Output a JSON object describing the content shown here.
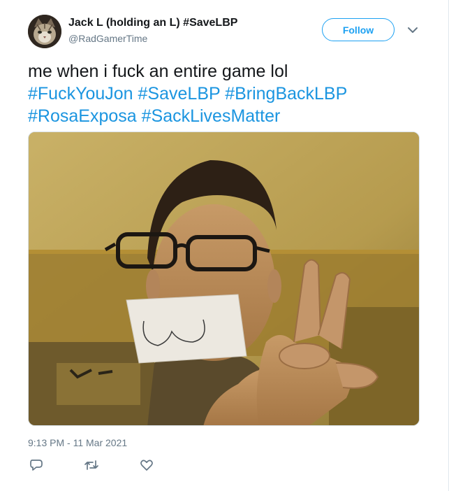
{
  "tweet": {
    "author": {
      "display_name": "Jack L (holding an L) #SaveLBP",
      "handle": "@RadGamerTime"
    },
    "follow_label": "Follow",
    "text_plain": "me when i fuck an entire game lol",
    "hashtags": [
      "#FuckYouJon",
      "#SaveLBP",
      "#BringBackLBP",
      "#RosaExposa",
      "#SackLivesMatter"
    ],
    "timestamp": "9:13 PM - 11 Mar 2021",
    "icons": {
      "avatar": "cat-avatar",
      "menu": "chevron-down-icon",
      "reply": "reply-icon",
      "retweet": "retweet-icon",
      "like": "heart-icon"
    }
  },
  "colors": {
    "link_blue": "#1b95e0",
    "follow_blue": "#1da1f2",
    "secondary_text": "#657786",
    "primary_text": "#14171a"
  }
}
